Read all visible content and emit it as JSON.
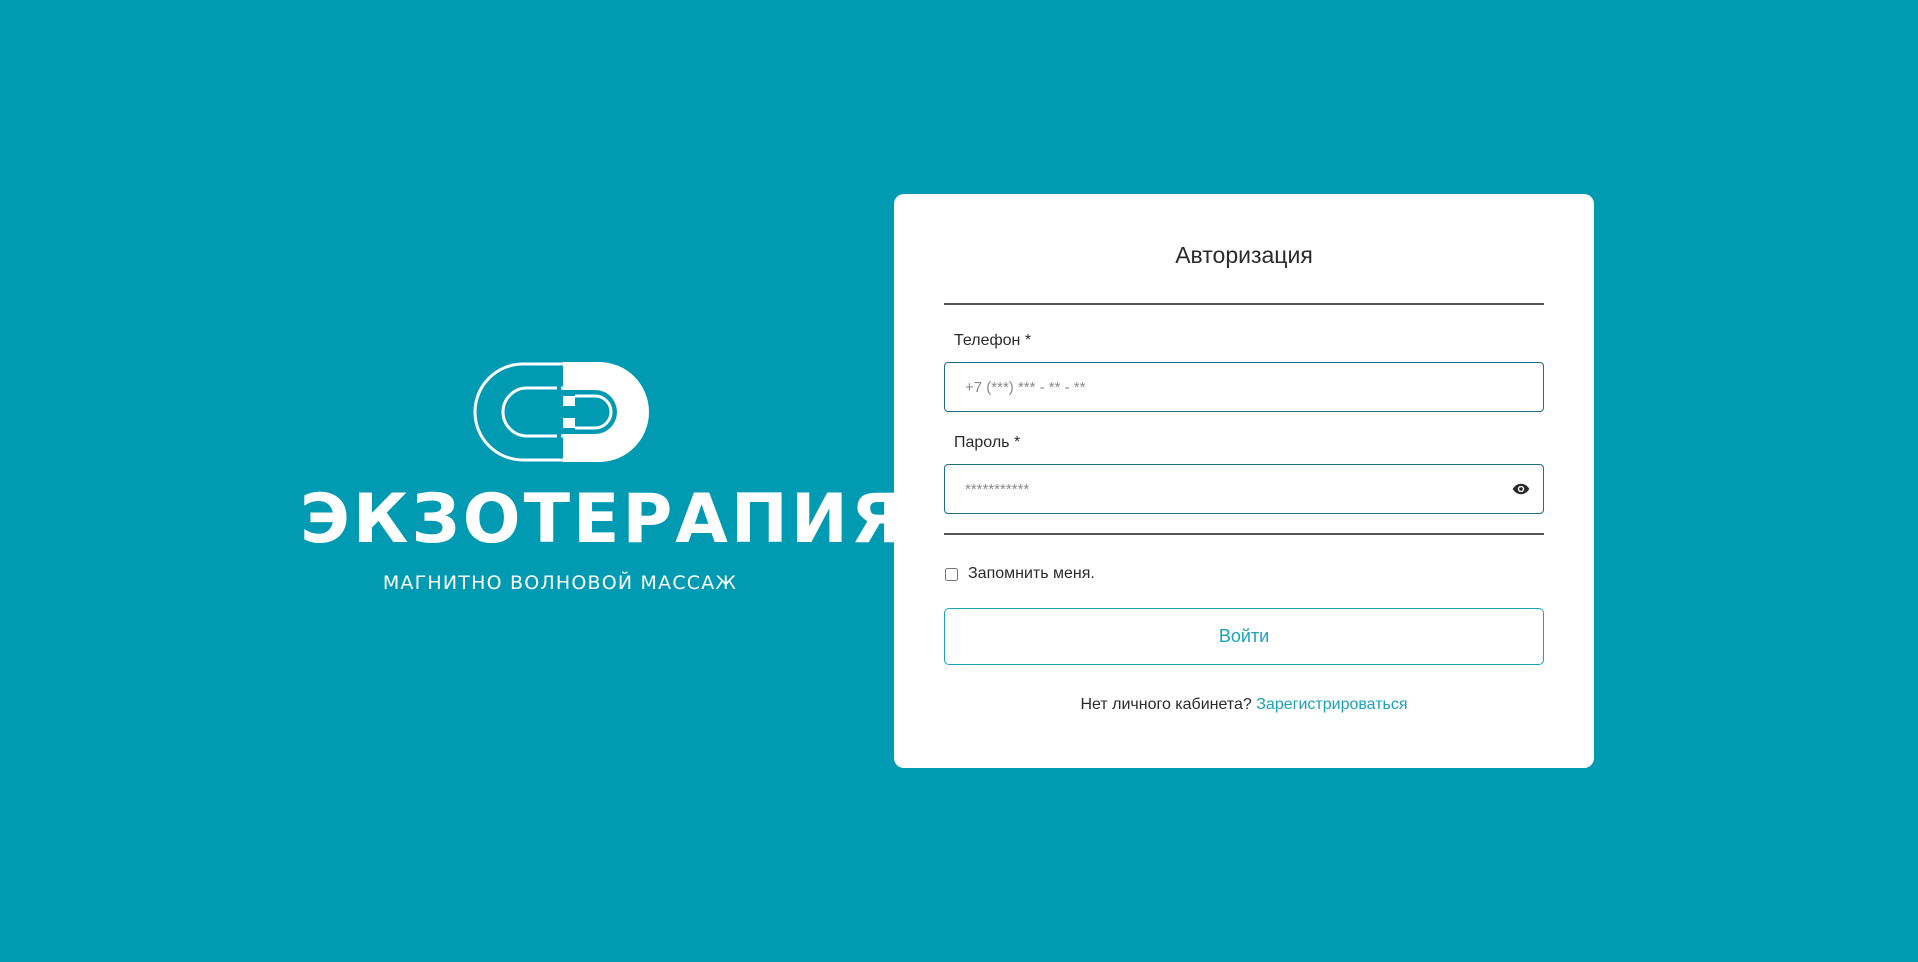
{
  "brand": {
    "name": "ЭКЗОТЕРАПИЯ",
    "tagline": "МАГНИТНО ВОЛНОВОЙ МАССАЖ",
    "logo_icon": "magnet-capsule-logo"
  },
  "auth": {
    "title": "Авторизация",
    "phone": {
      "label": "Телефон *",
      "placeholder": "+7 (***) *** - ** - **",
      "value": ""
    },
    "password": {
      "label": "Пароль *",
      "placeholder": "***********",
      "value": "",
      "toggle_icon": "eye-icon"
    },
    "remember": {
      "label": "Запомнить меня.",
      "checked": false
    },
    "submit_label": "Войти",
    "signup_prompt": "Нет личного кабинета?",
    "signup_link": "Зарегистрироваться"
  },
  "colors": {
    "background": "#009bb3",
    "accent": "#1aa3b8",
    "card": "#ffffff"
  }
}
